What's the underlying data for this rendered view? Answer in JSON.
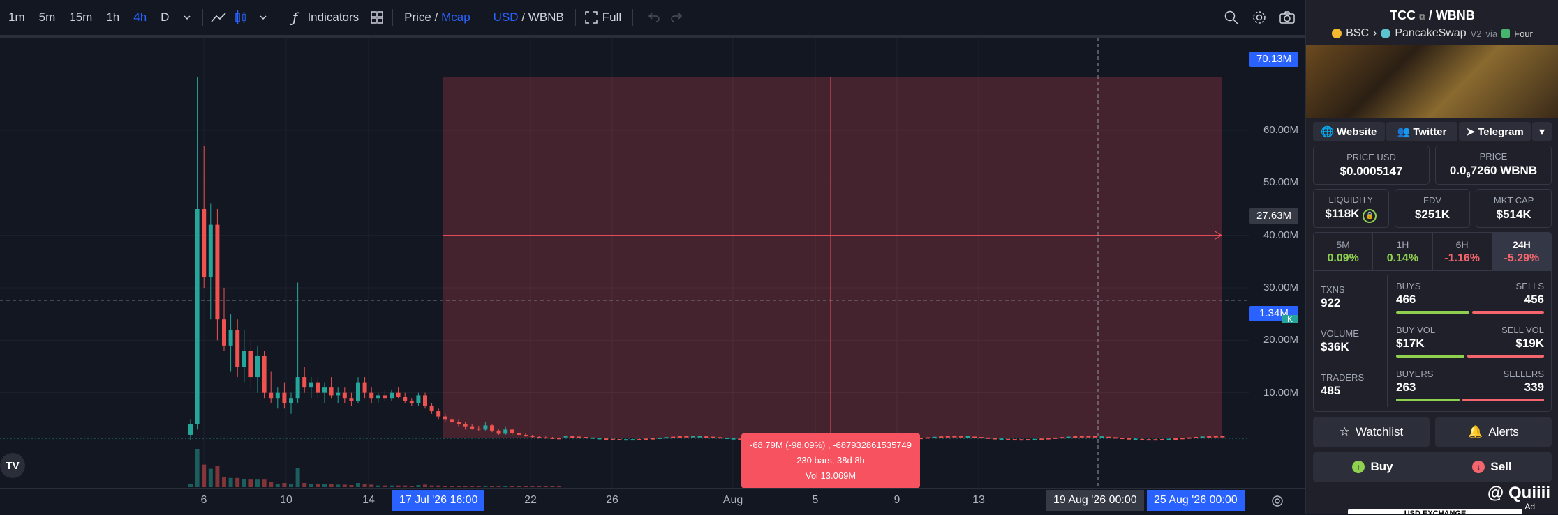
{
  "toolbar": {
    "timeframes": [
      "1m",
      "5m",
      "15m",
      "1h",
      "4h",
      "D"
    ],
    "active_timeframe": "4h",
    "indicators_label": "Indicators",
    "price_label": "Price",
    "mcap_label": "Mcap",
    "usd_label": "USD",
    "wbnb_label": "WBNB",
    "full_label": "Full",
    "slash": "/"
  },
  "chart_data": {
    "type": "candlestick",
    "price_axis_ticks": [
      "60.00M",
      "50.00M",
      "40.00M",
      "30.00M",
      "20.00M",
      "10.00M"
    ],
    "time_axis_ticks": [
      "6",
      "10",
      "14",
      "22",
      "26",
      "Aug",
      "5",
      "9",
      "13"
    ],
    "highlight_tags": {
      "range_top": "70.13M",
      "crosshair": "27.63M",
      "current": "1.34M",
      "range_start_time": "17 Jul '26   16:00",
      "crosshair_time": "19 Aug '26   00:00",
      "range_end_time": "25 Aug '26   00:00"
    },
    "measure": {
      "line1": "-68.79M (-98.09%) , -687932861535749",
      "line2": "230 bars, 38d 8h",
      "line3": "Vol 13.069M"
    },
    "ylim": [
      0,
      75
    ],
    "unit": "M",
    "series": [
      {
        "x": 0,
        "o": 2,
        "h": 5,
        "l": 1,
        "c": 4
      },
      {
        "x": 1,
        "o": 4,
        "h": 70.1,
        "l": 3,
        "c": 45
      },
      {
        "x": 2,
        "o": 45,
        "h": 57,
        "l": 30,
        "c": 32
      },
      {
        "x": 3,
        "o": 32,
        "h": 46,
        "l": 24,
        "c": 42
      },
      {
        "x": 4,
        "o": 42,
        "h": 45,
        "l": 20,
        "c": 24
      },
      {
        "x": 5,
        "o": 24,
        "h": 30,
        "l": 18,
        "c": 19
      },
      {
        "x": 6,
        "o": 19,
        "h": 25,
        "l": 14,
        "c": 22
      },
      {
        "x": 7,
        "o": 22,
        "h": 24,
        "l": 13,
        "c": 15
      },
      {
        "x": 8,
        "o": 15,
        "h": 22,
        "l": 12,
        "c": 18
      },
      {
        "x": 9,
        "o": 18,
        "h": 20,
        "l": 11,
        "c": 13
      },
      {
        "x": 10,
        "o": 13,
        "h": 19,
        "l": 10,
        "c": 17
      },
      {
        "x": 11,
        "o": 17,
        "h": 18,
        "l": 9,
        "c": 10
      },
      {
        "x": 12,
        "o": 10,
        "h": 14,
        "l": 8,
        "c": 9
      },
      {
        "x": 13,
        "o": 9,
        "h": 11,
        "l": 7,
        "c": 10
      },
      {
        "x": 14,
        "o": 10,
        "h": 12,
        "l": 7,
        "c": 8
      },
      {
        "x": 15,
        "o": 8,
        "h": 10,
        "l": 6,
        "c": 9
      },
      {
        "x": 16,
        "o": 9,
        "h": 31,
        "l": 8,
        "c": 13
      },
      {
        "x": 17,
        "o": 13,
        "h": 15,
        "l": 10,
        "c": 11
      },
      {
        "x": 18,
        "o": 11,
        "h": 13,
        "l": 9,
        "c": 12
      },
      {
        "x": 19,
        "o": 12,
        "h": 13,
        "l": 9,
        "c": 10
      },
      {
        "x": 20,
        "o": 10,
        "h": 12,
        "l": 8,
        "c": 11
      },
      {
        "x": 21,
        "o": 11,
        "h": 13,
        "l": 9,
        "c": 9.5
      },
      {
        "x": 22,
        "o": 9.5,
        "h": 11,
        "l": 8,
        "c": 10
      },
      {
        "x": 23,
        "o": 10,
        "h": 11,
        "l": 8,
        "c": 9
      },
      {
        "x": 24,
        "o": 9,
        "h": 10,
        "l": 7.5,
        "c": 8.5
      },
      {
        "x": 25,
        "o": 8.5,
        "h": 13,
        "l": 8,
        "c": 12
      },
      {
        "x": 26,
        "o": 12,
        "h": 13,
        "l": 9,
        "c": 10
      },
      {
        "x": 27,
        "o": 10,
        "h": 11,
        "l": 8,
        "c": 9
      },
      {
        "x": 28,
        "o": 9,
        "h": 10,
        "l": 8,
        "c": 9.5
      },
      {
        "x": 29,
        "o": 9.5,
        "h": 10.5,
        "l": 8.5,
        "c": 9
      },
      {
        "x": 30,
        "o": 9,
        "h": 10.5,
        "l": 8.5,
        "c": 10
      },
      {
        "x": 31,
        "o": 10,
        "h": 11,
        "l": 9,
        "c": 9.2
      },
      {
        "x": 32,
        "o": 9.2,
        "h": 10,
        "l": 8,
        "c": 8.5
      },
      {
        "x": 33,
        "o": 8.5,
        "h": 9,
        "l": 7.5,
        "c": 8
      },
      {
        "x": 34,
        "o": 8,
        "h": 10,
        "l": 7.5,
        "c": 9.5
      },
      {
        "x": 35,
        "o": 9.5,
        "h": 10,
        "l": 7,
        "c": 7.5
      },
      {
        "x": 36,
        "o": 7.5,
        "h": 8,
        "l": 6,
        "c": 6.5
      },
      {
        "x": 37,
        "o": 6.5,
        "h": 7,
        "l": 5,
        "c": 5.5
      },
      {
        "x": 38,
        "o": 5.5,
        "h": 6,
        "l": 4.5,
        "c": 5
      },
      {
        "x": 39,
        "o": 5,
        "h": 5.5,
        "l": 4,
        "c": 4.5
      },
      {
        "x": 40,
        "o": 4.5,
        "h": 5,
        "l": 3.5,
        "c": 4
      },
      {
        "x": 41,
        "o": 4,
        "h": 4.5,
        "l": 3,
        "c": 3.5
      },
      {
        "x": 42,
        "o": 3.5,
        "h": 4,
        "l": 3,
        "c": 3.2
      },
      {
        "x": 43,
        "o": 3.2,
        "h": 3.6,
        "l": 2.8,
        "c": 3
      },
      {
        "x": 44,
        "o": 3,
        "h": 4.5,
        "l": 2.8,
        "c": 3.8
      },
      {
        "x": 45,
        "o": 3.8,
        "h": 4,
        "l": 2.5,
        "c": 2.8
      },
      {
        "x": 46,
        "o": 2.8,
        "h": 3,
        "l": 2,
        "c": 2.2
      },
      {
        "x": 47,
        "o": 2.2,
        "h": 3.5,
        "l": 2,
        "c": 3
      },
      {
        "x": 48,
        "o": 3,
        "h": 3.2,
        "l": 2,
        "c": 2.3
      },
      {
        "x": 49,
        "o": 2.3,
        "h": 2.6,
        "l": 1.8,
        "c": 2
      },
      {
        "x": 50,
        "o": 2,
        "h": 2.3,
        "l": 1.6,
        "c": 1.8
      },
      {
        "x": 51,
        "o": 1.8,
        "h": 2,
        "l": 1.4,
        "c": 1.6
      },
      {
        "x": 52,
        "o": 1.6,
        "h": 1.8,
        "l": 1.3,
        "c": 1.5
      },
      {
        "x": 53,
        "o": 1.5,
        "h": 1.7,
        "l": 1.3,
        "c": 1.4
      },
      {
        "x": 54,
        "o": 1.4,
        "h": 1.6,
        "l": 1.2,
        "c": 1.35
      },
      {
        "x": 55,
        "o": 1.35,
        "h": 1.5,
        "l": 1.2,
        "c": 1.34
      }
    ]
  },
  "sidebar": {
    "pair_base": "TCC",
    "pair_sep": "/",
    "pair_quote": "WBNB",
    "chain": "BSC",
    "dex": "PancakeSwap",
    "dex_version": "V2",
    "via": "via",
    "launchpad": "Four",
    "links": [
      "Website",
      "Twitter",
      "Telegram"
    ],
    "price_usd_label": "PRICE USD",
    "price_usd": "$0.0005147",
    "price_label": "PRICE",
    "price_prefix": "0.0",
    "price_sub": "6",
    "price_rest": "7260 WBNB",
    "liquidity_label": "LIQUIDITY",
    "liquidity": "$118K",
    "fdv_label": "FDV",
    "fdv": "$251K",
    "mktcap_label": "MKT CAP",
    "mktcap": "$514K",
    "timeframes": [
      {
        "name": "5M",
        "value": "0.09%",
        "dir": "up"
      },
      {
        "name": "1H",
        "value": "0.14%",
        "dir": "up"
      },
      {
        "name": "6H",
        "value": "-1.16%",
        "dir": "down"
      },
      {
        "name": "24H",
        "value": "-5.29%",
        "dir": "down"
      }
    ],
    "txns_label": "TXNS",
    "txns": "922",
    "buys_label": "BUYS",
    "buys": "466",
    "sells_label": "SELLS",
    "sells": "456",
    "buys_ratio": 0.505,
    "volume_label": "VOLUME",
    "volume": "$36K",
    "buy_vol_label": "BUY VOL",
    "buy_vol": "$17K",
    "sell_vol_label": "SELL VOL",
    "sell_vol": "$19K",
    "buy_vol_ratio": 0.47,
    "traders_label": "TRADERS",
    "traders": "485",
    "buyers_label": "BUYERS",
    "buyers": "263",
    "sellers_label": "SELLERS",
    "sellers": "339",
    "buyers_ratio": 0.437,
    "watchlist_label": "Watchlist",
    "alerts_label": "Alerts",
    "buy_label": "Buy",
    "sell_label": "Sell",
    "bottom_cut_text": "USD EXCHANGE",
    "watermark": "@ Quiiii",
    "ad_label": "Ad"
  },
  "colors": {
    "up": "#26a69a",
    "down": "#ef5350",
    "accent": "#2962ff",
    "measure": "#f7525f"
  }
}
